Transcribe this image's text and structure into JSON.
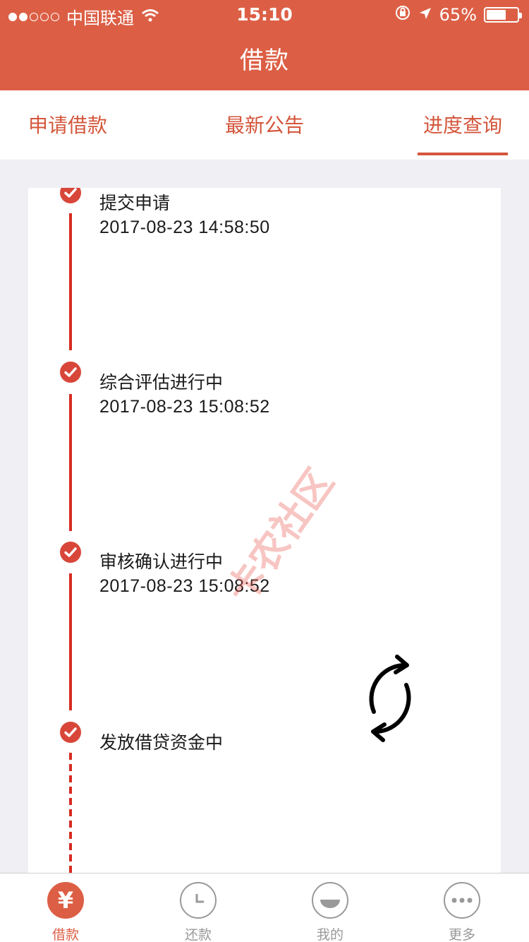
{
  "status_bar": {
    "carrier": "中国联通",
    "time": "15:10",
    "battery": "65%",
    "signal_dots": [
      true,
      true,
      false,
      false,
      false
    ]
  },
  "header": {
    "title": "借款"
  },
  "tabs": [
    {
      "label": "申请借款",
      "active": false
    },
    {
      "label": "最新公告",
      "active": false
    },
    {
      "label": "进度查询",
      "active": true
    }
  ],
  "timeline": [
    {
      "title": "提交申请",
      "time": "2017-08-23 14:58:50"
    },
    {
      "title": "综合评估进行中",
      "time": "2017-08-23 15:08:52"
    },
    {
      "title": "审核确认进行中",
      "time": "2017-08-23 15:08:52"
    },
    {
      "title": "发放借贷资金中",
      "time": ""
    }
  ],
  "watermark": "卡农社区",
  "bottom_nav": [
    {
      "label": "借款",
      "icon": "yen-icon",
      "glyph": "¥",
      "active": true
    },
    {
      "label": "还款",
      "icon": "clock-icon",
      "active": false
    },
    {
      "label": "我的",
      "icon": "smile-icon",
      "active": false
    },
    {
      "label": "更多",
      "icon": "more-icon",
      "active": false
    }
  ],
  "colors": {
    "brand": "#dc5f45",
    "timeline": "#d62c22",
    "inactive": "#999999"
  }
}
